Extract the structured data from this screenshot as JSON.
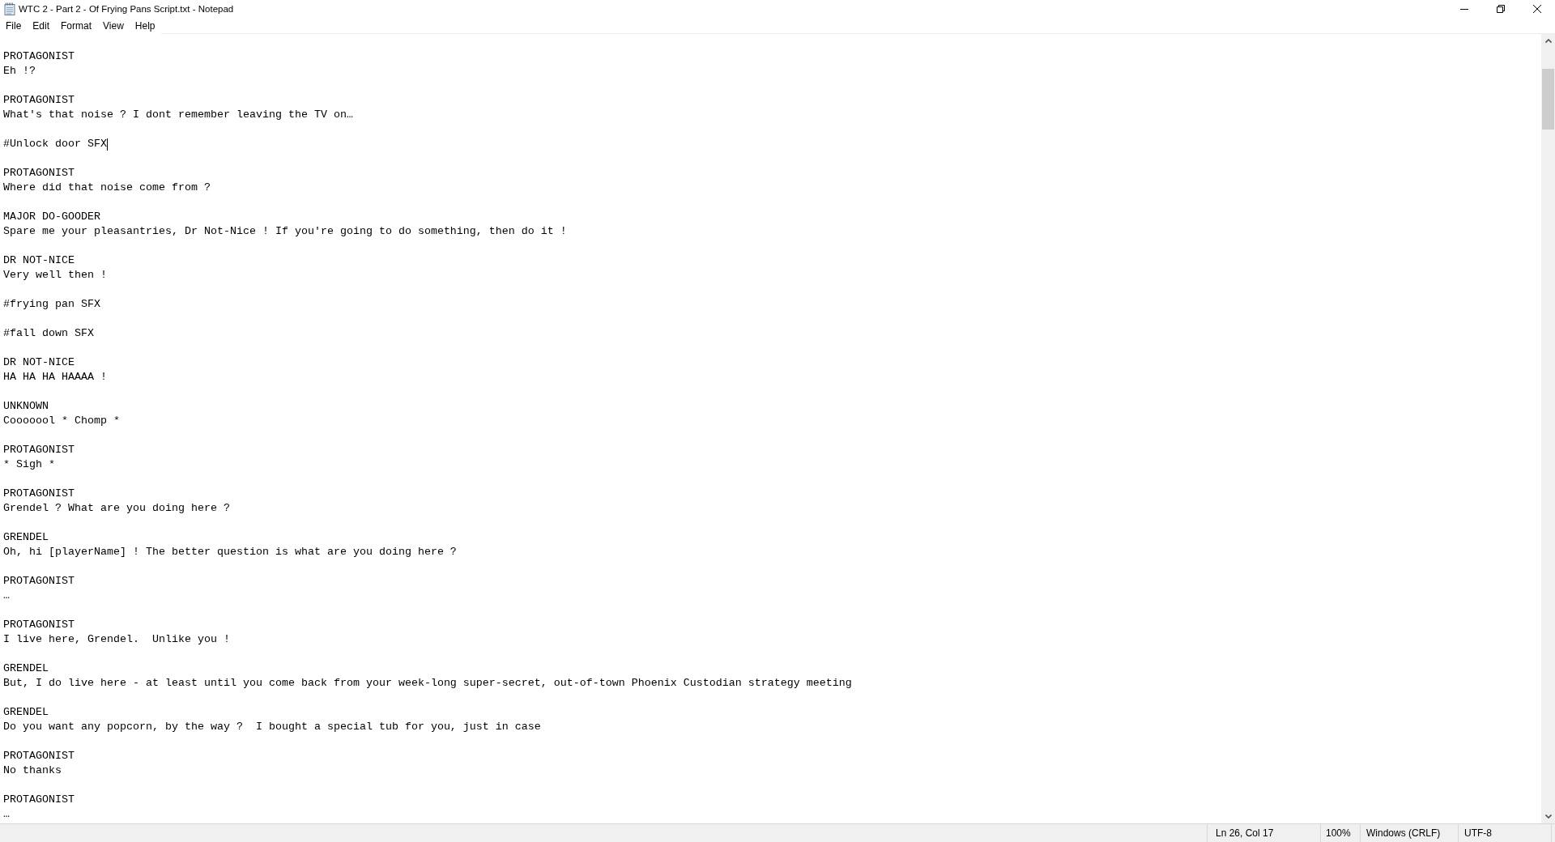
{
  "window": {
    "title": "WTC 2 - Part 2 - Of Frying Pans Script.txt - Notepad"
  },
  "menu": [
    "File",
    "Edit",
    "Format",
    "View",
    "Help"
  ],
  "editor": {
    "blocks": [
      {
        "lines": [
          "PROTAGONIST",
          "Eh !?"
        ],
        "caret": false
      },
      {
        "lines": [
          "PROTAGONIST",
          "What's that noise ? I dont remember leaving the TV on…"
        ],
        "caret": false
      },
      {
        "lines": [
          "#Unlock door SFX"
        ],
        "caret": true
      },
      {
        "lines": [
          "PROTAGONIST",
          "Where did that noise come from ?"
        ],
        "caret": false
      },
      {
        "lines": [
          "MAJOR DO-GOODER",
          "Spare me your pleasantries, Dr Not-Nice ! If you're going to do something, then do it !"
        ],
        "caret": false
      },
      {
        "lines": [
          "DR NOT-NICE",
          "Very well then !"
        ],
        "caret": false
      },
      {
        "lines": [
          "#frying pan SFX"
        ],
        "caret": false
      },
      {
        "lines": [
          "#fall down SFX"
        ],
        "caret": false
      },
      {
        "lines": [
          "DR NOT-NICE",
          "HA HA HA HAAAA !"
        ],
        "caret": false
      },
      {
        "lines": [
          "UNKNOWN",
          "Cooooool * Chomp *"
        ],
        "caret": false
      },
      {
        "lines": [
          "PROTAGONIST",
          "* Sigh *"
        ],
        "caret": false
      },
      {
        "lines": [
          "PROTAGONIST",
          "Grendel ? What are you doing here ?"
        ],
        "caret": false
      },
      {
        "lines": [
          "GRENDEL",
          "Oh, hi [playerName] ! The better question is what are you doing here ?"
        ],
        "caret": false
      },
      {
        "lines": [
          "PROTAGONIST",
          "…"
        ],
        "caret": false
      },
      {
        "lines": [
          "PROTAGONIST",
          "I live here, Grendel.  Unlike you !"
        ],
        "caret": false
      },
      {
        "lines": [
          "GRENDEL",
          "But, I do live here - at least until you come back from your week-long super-secret, out-of-town Phoenix Custodian strategy meeting"
        ],
        "caret": false
      },
      {
        "lines": [
          "GRENDEL",
          "Do you want any popcorn, by the way ?  I bought a special tub for you, just in case"
        ],
        "caret": false
      },
      {
        "lines": [
          "PROTAGONIST",
          "No thanks"
        ],
        "caret": false
      },
      {
        "lines": [
          "PROTAGONIST",
          "…"
        ],
        "caret": false
      }
    ]
  },
  "status_bar": {
    "cursor_position": "Ln 26, Col 17",
    "zoom": "100%",
    "line_ending": "Windows (CRLF)",
    "encoding": "UTF-8"
  }
}
